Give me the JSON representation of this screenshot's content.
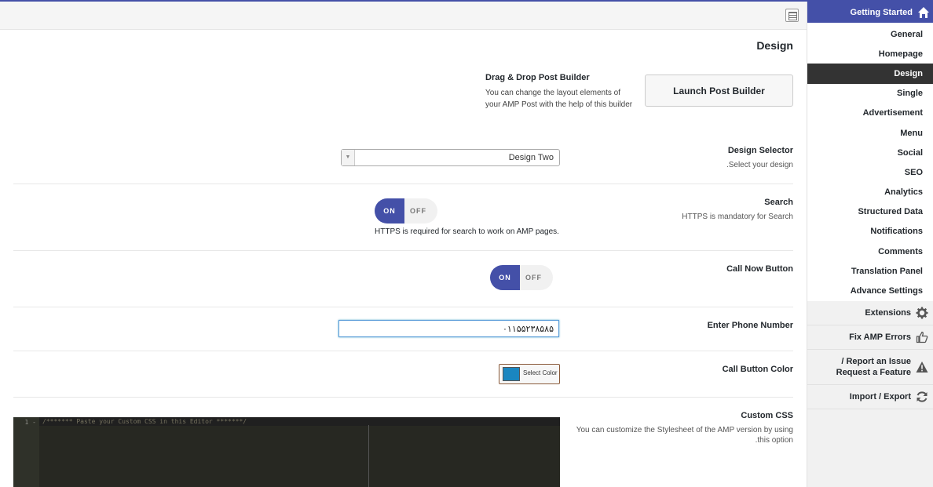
{
  "section_title": "Design",
  "post_builder": {
    "title": "Drag & Drop Post Builder",
    "description": "You can change the layout elements of your AMP Post with the help of this builder",
    "button_label": "Launch Post Builder"
  },
  "design_selector": {
    "title": "Design Selector",
    "subtitle": ".Select your design",
    "value": "Design Two"
  },
  "search": {
    "title": "Search",
    "subtitle": "HTTPS is mandatory for Search",
    "toggle_on": "ON",
    "toggle_off": "OFF",
    "note": "HTTPS is required for search to work on AMP pages."
  },
  "call_now": {
    "title": "Call Now Button",
    "toggle_on": "ON",
    "toggle_off": "OFF"
  },
  "phone": {
    "title": "Enter Phone Number",
    "value": "۰۱۱۵۵۲۳۸۵۸۵"
  },
  "call_color": {
    "title": "Call Button Color",
    "button_label": "Select Color",
    "color": "#1a86c0"
  },
  "custom_css": {
    "title": "Custom CSS",
    "subtitle_line1": "You can customize the Stylesheet of the AMP version by using",
    "subtitle_line2": ".this option",
    "line_number": "1 -",
    "editor_text": "/******* Paste your Custom CSS in this Editor *******/"
  },
  "sidebar": {
    "header": "Getting Started",
    "sub_items": [
      {
        "label": "General"
      },
      {
        "label": "Homepage"
      },
      {
        "label": "Design"
      },
      {
        "label": "Single"
      },
      {
        "label": "Advertisement"
      },
      {
        "label": "Menu"
      },
      {
        "label": "Social"
      },
      {
        "label": "SEO"
      },
      {
        "label": "Analytics"
      },
      {
        "label": "Structured Data"
      },
      {
        "label": "Notifications"
      },
      {
        "label": "Comments"
      },
      {
        "label": "Translation Panel"
      },
      {
        "label": "Advance Settings"
      }
    ],
    "extensions": "Extensions",
    "fix_errors": "Fix AMP Errors",
    "report_line1": "/ Report an Issue",
    "report_line2": "Request a Feature",
    "import_export": "Import / Export"
  },
  "colors": {
    "accent": "#4450a8",
    "active_menu": "#333333"
  }
}
